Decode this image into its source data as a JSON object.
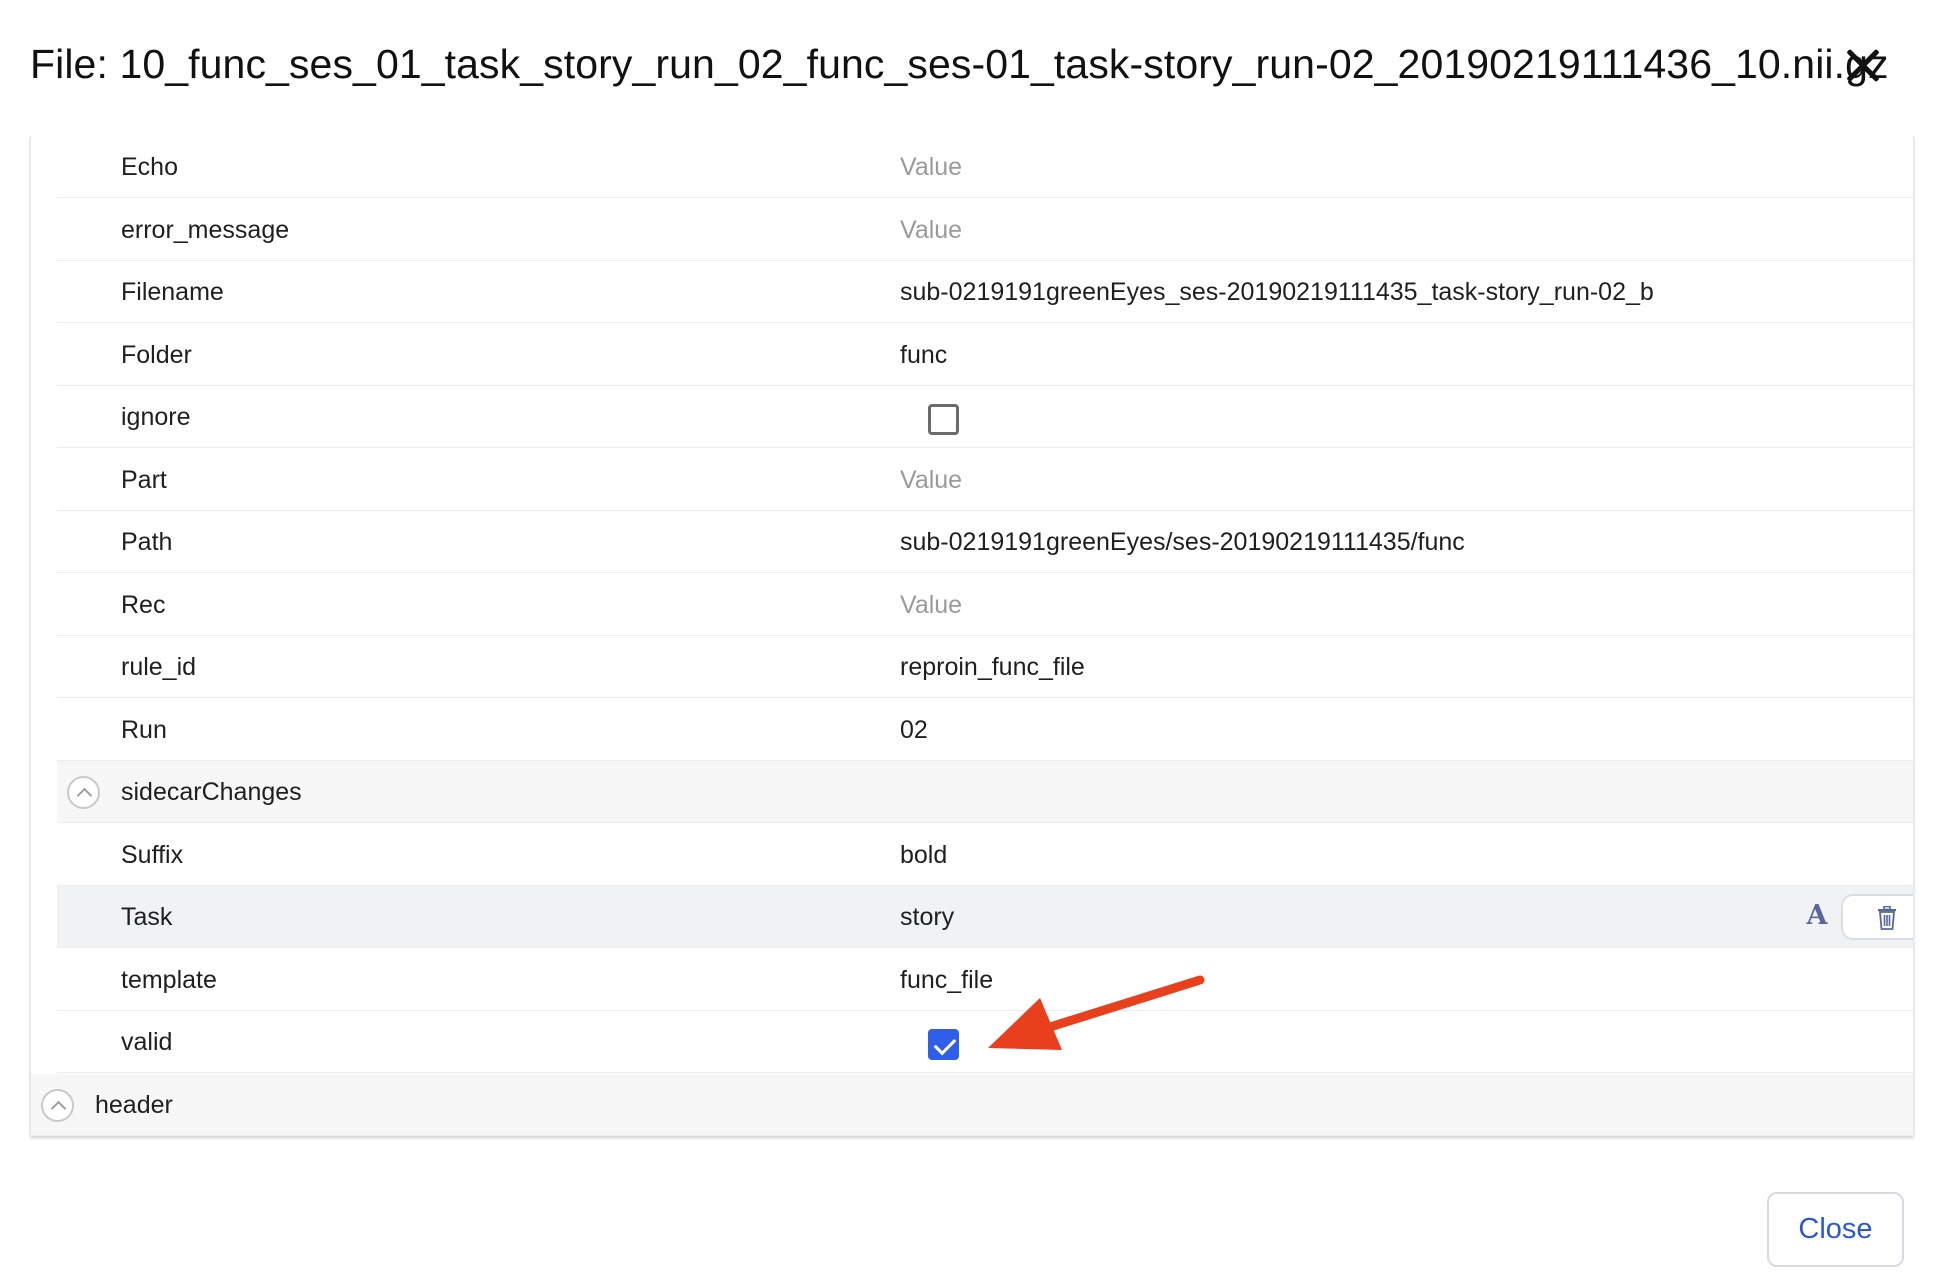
{
  "modal": {
    "title": "File: 10_func_ses_01_task_story_run_02_func_ses-01_task-story_run-02_20190219111436_10.nii.gz"
  },
  "rows": [
    {
      "key": "Echo",
      "value": "Value",
      "placeholder": true
    },
    {
      "key": "error_message",
      "value": "Value",
      "placeholder": true
    },
    {
      "key": "Filename",
      "value": "sub-0219191greenEyes_ses-20190219111435_task-story_run-02_b"
    },
    {
      "key": "Folder",
      "value": "func"
    },
    {
      "key": "ignore",
      "checkbox": false
    },
    {
      "key": "Part",
      "value": "Value",
      "placeholder": true
    },
    {
      "key": "Path",
      "value": "sub-0219191greenEyes/ses-20190219111435/func"
    },
    {
      "key": "Rec",
      "value": "Value",
      "placeholder": true
    },
    {
      "key": "rule_id",
      "value": "reproin_func_file"
    },
    {
      "key": "Run",
      "value": "02"
    },
    {
      "key": "sidecarChanges",
      "group": true
    },
    {
      "key": "Suffix",
      "value": "bold"
    },
    {
      "key": "Task",
      "value": "story",
      "hover": true
    },
    {
      "key": "template",
      "value": "func_file"
    },
    {
      "key": "valid",
      "checkbox": true
    },
    {
      "key": "header",
      "group": true,
      "top_level": true
    }
  ],
  "row_actions": {
    "font_icon": "font-A-icon",
    "font_glyph": "A",
    "delete_icon": "trash-icon"
  },
  "annotation": {
    "color": "#e8401c"
  },
  "footer": {
    "close_label": "Close"
  }
}
